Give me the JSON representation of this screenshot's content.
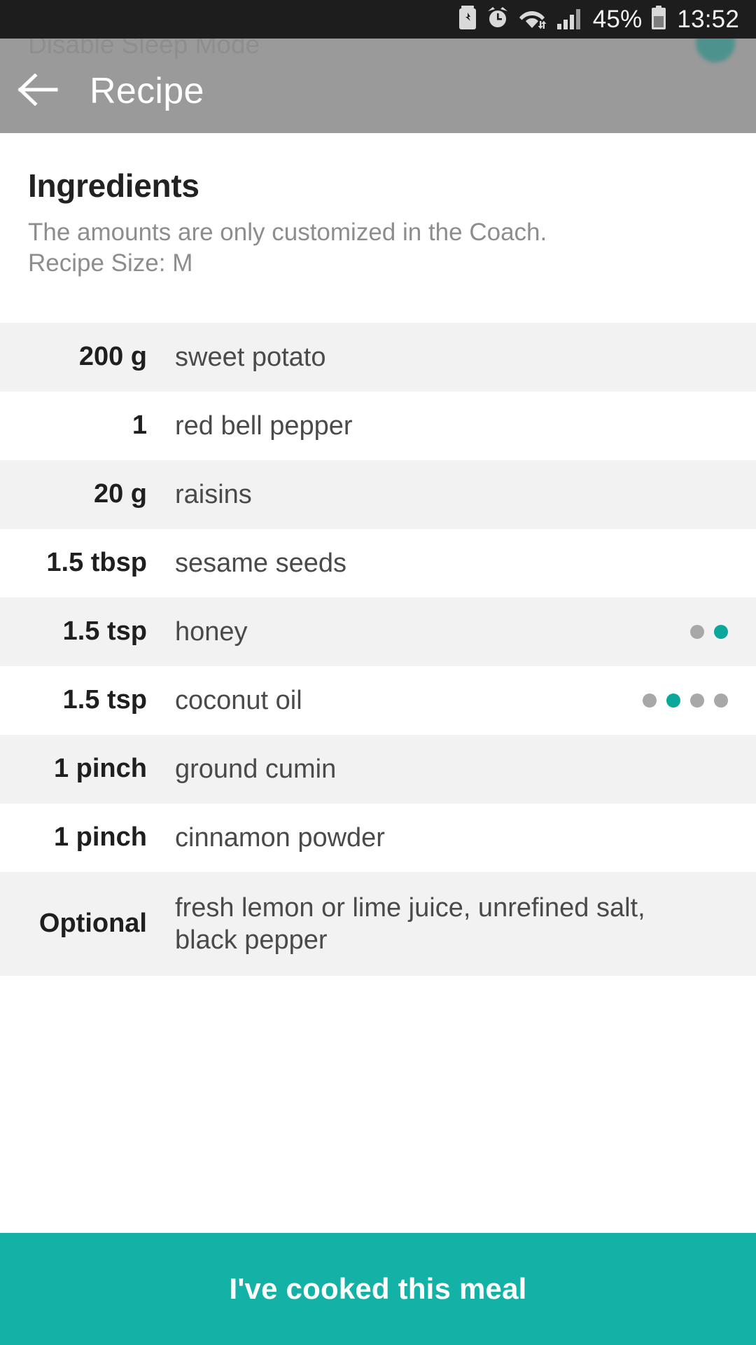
{
  "status_bar": {
    "battery_percent": "45%",
    "clock": "13:52",
    "icons": [
      "battery-saver-icon",
      "alarm-clock-icon",
      "wifi-icon",
      "signal-bars-icon",
      "battery-icon"
    ]
  },
  "background_overlay": {
    "dimmed_label": "Disable Sleep Mode"
  },
  "toolbar": {
    "back_icon": "back-arrow-icon",
    "title": "Recipe"
  },
  "main": {
    "section_title": "Ingredients",
    "subtitle_line1": "The amounts are only customized in the Coach.",
    "subtitle_line2": "Recipe Size: M",
    "ingredients": [
      {
        "amount": "200 g",
        "name": "sweet potato",
        "dots_total": 0,
        "dots_active": -1
      },
      {
        "amount": "1",
        "name": "red bell pepper",
        "dots_total": 0,
        "dots_active": -1
      },
      {
        "amount": "20 g",
        "name": "raisins",
        "dots_total": 0,
        "dots_active": -1
      },
      {
        "amount": "1.5 tbsp",
        "name": "sesame seeds",
        "dots_total": 0,
        "dots_active": -1
      },
      {
        "amount": "1.5 tsp",
        "name": "honey",
        "dots_total": 2,
        "dots_active": 1
      },
      {
        "amount": "1.5 tsp",
        "name": "coconut oil",
        "dots_total": 4,
        "dots_active": 1
      },
      {
        "amount": "1 pinch",
        "name": "ground cumin",
        "dots_total": 0,
        "dots_active": -1
      },
      {
        "amount": "1 pinch",
        "name": "cinnamon powder",
        "dots_total": 0,
        "dots_active": -1
      },
      {
        "amount": "Optional",
        "name": "fresh lemon or lime juice, unrefined salt, black pepper",
        "dots_total": 0,
        "dots_active": -1
      }
    ]
  },
  "cta": {
    "label": "I've cooked this meal"
  },
  "colors": {
    "accent_teal": "#14b2a6",
    "dot_active": "#0aa79b",
    "dot_inactive": "#a8a8a8",
    "row_alt": "#f2f2f2",
    "status_bar_bg": "#1d1d1d",
    "overlay_gray": "#9a9a9a"
  }
}
